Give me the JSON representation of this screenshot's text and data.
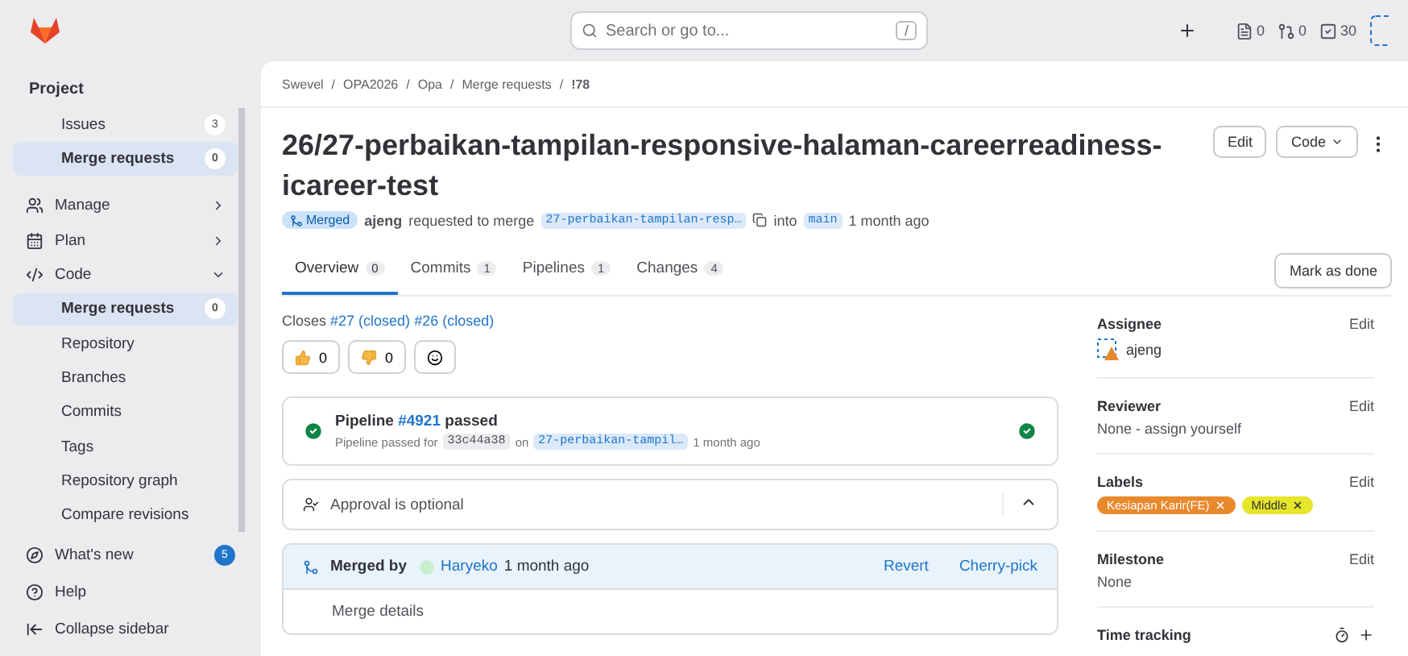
{
  "top_bar": {
    "search_placeholder": "Search or go to...",
    "shortcut_key": "/",
    "counters": [
      {
        "kind": "issues",
        "count": "0"
      },
      {
        "kind": "merge_requests",
        "count": "0"
      },
      {
        "kind": "todos",
        "count": "30"
      }
    ]
  },
  "sidebar": {
    "heading": "Project",
    "items": [
      {
        "kind": "sub",
        "label": "Issues",
        "badge": "3",
        "selected": false
      },
      {
        "kind": "sub",
        "label": "Merge requests",
        "badge": "0",
        "selected": true
      },
      {
        "kind": "section",
        "label": "Manage",
        "expanded": false
      },
      {
        "kind": "section",
        "label": "Plan",
        "expanded": false
      },
      {
        "kind": "section",
        "label": "Code",
        "expanded": true
      },
      {
        "kind": "sub",
        "label": "Merge requests",
        "badge": "0",
        "selected": true
      },
      {
        "kind": "sub",
        "label": "Repository",
        "selected": false
      },
      {
        "kind": "sub",
        "label": "Branches",
        "selected": false
      },
      {
        "kind": "sub",
        "label": "Commits",
        "selected": false
      },
      {
        "kind": "sub",
        "label": "Tags",
        "selected": false
      },
      {
        "kind": "sub",
        "label": "Repository graph",
        "selected": false
      },
      {
        "kind": "sub",
        "label": "Compare revisions",
        "selected": false
      }
    ],
    "footer": [
      {
        "label": "What's new",
        "badge": "5"
      },
      {
        "label": "Help"
      },
      {
        "label": "Collapse sidebar"
      }
    ]
  },
  "breadcrumb": [
    "Swevel",
    "OPA2026",
    "Opa",
    "Merge requests",
    "!78"
  ],
  "breadcrumb_separator": "/",
  "title": "26/27-perbaikan-tampilan-responsive-halaman-careerreadiness-icareer-test",
  "header_buttons": [
    "Edit",
    "Code"
  ],
  "meta": {
    "status": "Merged",
    "author": "ajeng",
    "text": "requested to merge",
    "source_branch": "27-perbaikan-tampilan-resp…",
    "into": "into",
    "target_branch": "main",
    "time": "1 month ago"
  },
  "tabs": [
    {
      "label": "Overview",
      "count": "0",
      "selected": true
    },
    {
      "label": "Commits",
      "count": "1",
      "selected": false
    },
    {
      "label": "Pipelines",
      "count": "1",
      "selected": false
    },
    {
      "label": "Changes",
      "count": "4",
      "selected": false
    }
  ],
  "mark_done": "Mark as done",
  "closes": {
    "text": "Closes",
    "links": [
      "#27 (closed)",
      "#26 (closed)"
    ]
  },
  "reactions": [
    {
      "kind": "thumbs_up",
      "count": "0"
    },
    {
      "kind": "thumbs_down",
      "count": "0"
    }
  ],
  "pipeline": {
    "title": "Pipeline",
    "link": "#4921",
    "status": "passed",
    "sub": "Pipeline passed for",
    "commit": "33c44a38",
    "on": "on",
    "branch": "27-perbaikan-tampil…",
    "time": "1 month ago"
  },
  "approval": {
    "text": "Approval is optional",
    "expanded": true
  },
  "merged": {
    "label": "Merged by",
    "user": "Haryeko",
    "time": "1 month ago",
    "actions": [
      "Revert",
      "Cherry-pick"
    ],
    "details": "Merge details"
  },
  "side": [
    {
      "kind": "user",
      "title": "Assignee",
      "action": "Edit",
      "value": "ajeng"
    },
    {
      "kind": "text",
      "title": "Reviewer",
      "action": "Edit",
      "value": "None - assign yourself"
    },
    {
      "kind": "labels",
      "title": "Labels",
      "action": "Edit",
      "labels": [
        {
          "text": "Kesiapan Karir(FE)",
          "color": "#e8892c"
        },
        {
          "text": "Middle",
          "color": "#e6e62a"
        }
      ]
    },
    {
      "kind": "text",
      "title": "Milestone",
      "action": "Edit",
      "value": "None"
    },
    {
      "kind": "time",
      "title": "Time tracking"
    }
  ]
}
